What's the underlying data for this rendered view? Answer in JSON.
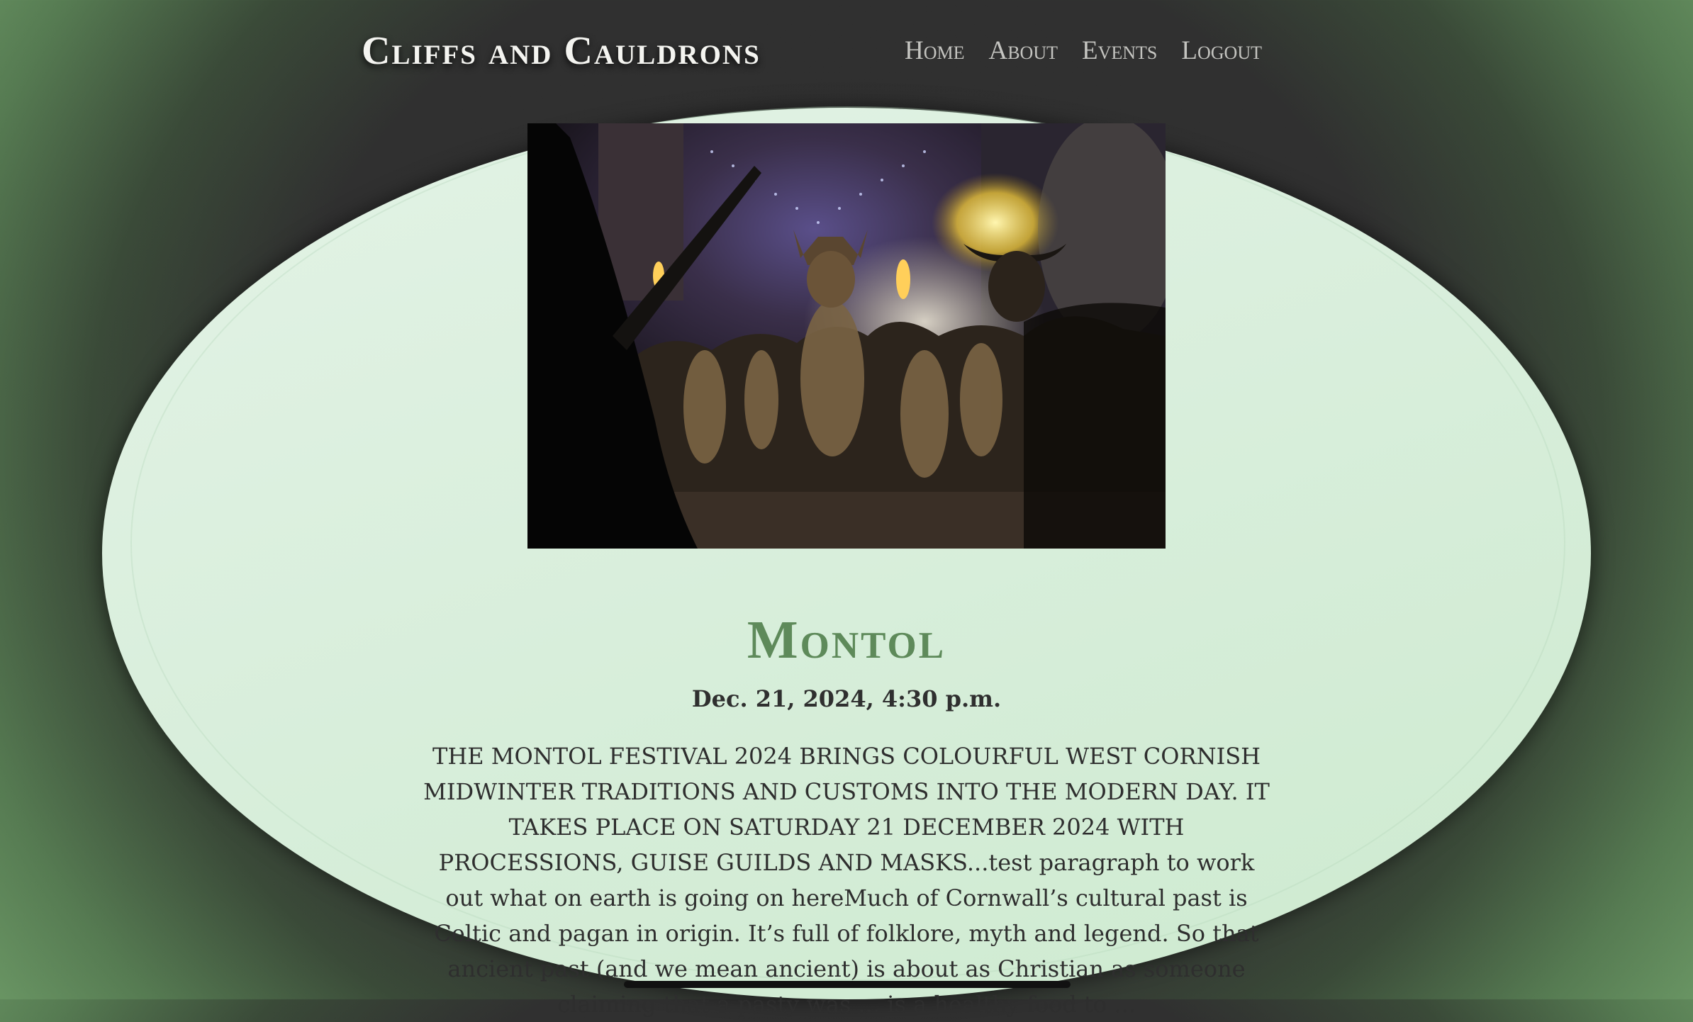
{
  "site": {
    "brand": "Cliffs and Cauldrons"
  },
  "nav": {
    "items": [
      "Home",
      "About",
      "Events",
      "Logout"
    ]
  },
  "event": {
    "title": "Montol",
    "date": "Dec. 21, 2024, 4:30 p.m.",
    "description": "THE MONTOL FESTIVAL 2024 BRINGS COLOURFUL WEST CORNISH MIDWINTER TRADITIONS AND CUSTOMS INTO THE MODERN DAY. IT TAKES PLACE ON SATURDAY 21 DECEMBER 2024 WITH PROCESSIONS, GUISE GUILDS AND MASKS...test paragraph to work out what on earth is going on hereMuch of Cornwall’s cultural past is Celtic and pagan in origin. It’s full of folklore, myth and legend. So that ancient past (and we mean ancient) is about as Christian as someone claiming that a pasty was ... is a healthy food to ..."
  },
  "colors": {
    "title": "#5e8a5a",
    "background_edge": "#6a9664",
    "oval": "#d8eedb"
  }
}
